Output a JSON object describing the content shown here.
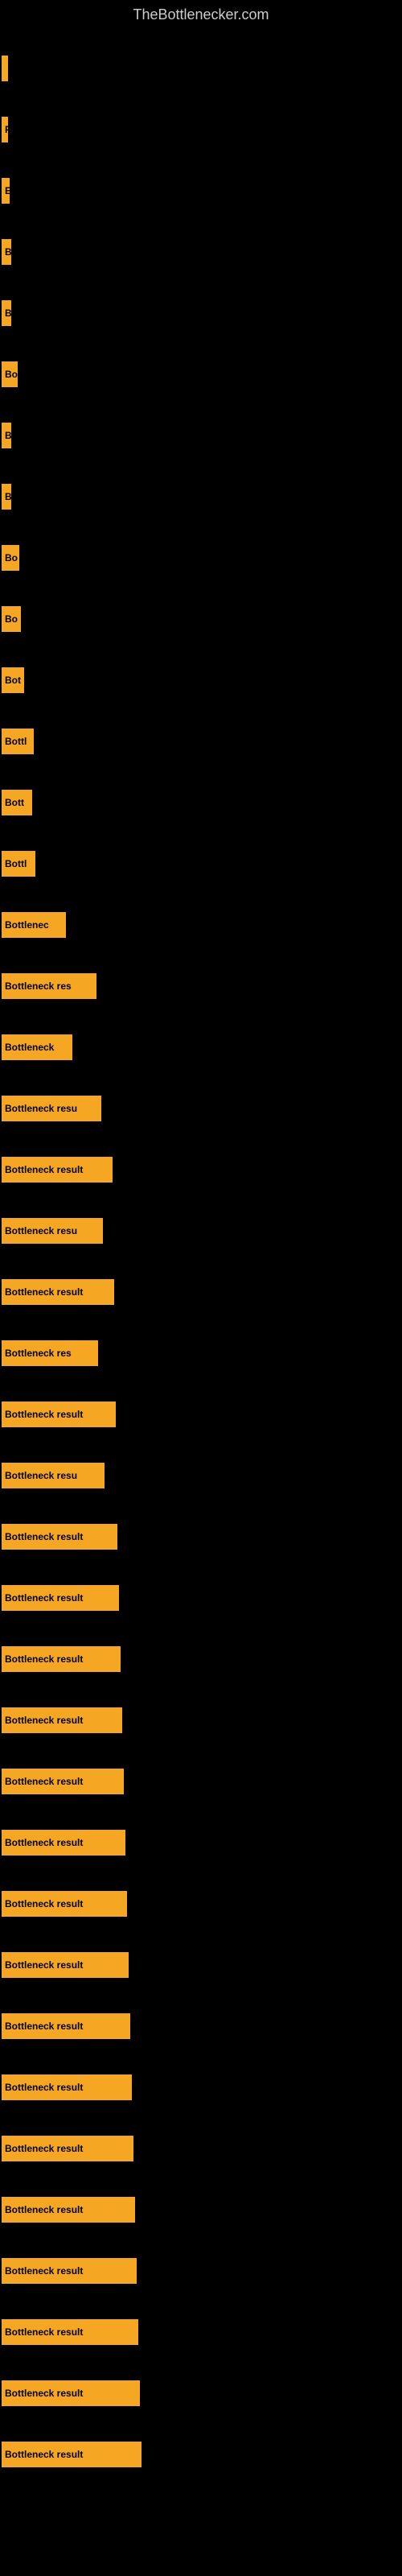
{
  "site": {
    "title": "TheBottlenecker.com"
  },
  "bars": [
    {
      "id": 1,
      "label": "",
      "width": 2
    },
    {
      "id": 2,
      "label": "P",
      "width": 8
    },
    {
      "id": 3,
      "label": "E",
      "width": 10
    },
    {
      "id": 4,
      "label": "B",
      "width": 12
    },
    {
      "id": 5,
      "label": "B",
      "width": 12
    },
    {
      "id": 6,
      "label": "Bo",
      "width": 20
    },
    {
      "id": 7,
      "label": "B",
      "width": 12
    },
    {
      "id": 8,
      "label": "B",
      "width": 12
    },
    {
      "id": 9,
      "label": "Bo",
      "width": 22
    },
    {
      "id": 10,
      "label": "Bo",
      "width": 24
    },
    {
      "id": 11,
      "label": "Bot",
      "width": 28
    },
    {
      "id": 12,
      "label": "Bottl",
      "width": 40
    },
    {
      "id": 13,
      "label": "Bott",
      "width": 38
    },
    {
      "id": 14,
      "label": "Bottl",
      "width": 42
    },
    {
      "id": 15,
      "label": "Bottlenec",
      "width": 80
    },
    {
      "id": 16,
      "label": "Bottleneck res",
      "width": 118
    },
    {
      "id": 17,
      "label": "Bottleneck",
      "width": 88
    },
    {
      "id": 18,
      "label": "Bottleneck resu",
      "width": 124
    },
    {
      "id": 19,
      "label": "Bottleneck result",
      "width": 138
    },
    {
      "id": 20,
      "label": "Bottleneck resu",
      "width": 126
    },
    {
      "id": 21,
      "label": "Bottleneck result",
      "width": 140
    },
    {
      "id": 22,
      "label": "Bottleneck res",
      "width": 120
    },
    {
      "id": 23,
      "label": "Bottleneck result",
      "width": 142
    },
    {
      "id": 24,
      "label": "Bottleneck resu",
      "width": 128
    },
    {
      "id": 25,
      "label": "Bottleneck result",
      "width": 144
    },
    {
      "id": 26,
      "label": "Bottleneck result",
      "width": 146
    },
    {
      "id": 27,
      "label": "Bottleneck result",
      "width": 148
    },
    {
      "id": 28,
      "label": "Bottleneck result",
      "width": 150
    },
    {
      "id": 29,
      "label": "Bottleneck result",
      "width": 152
    },
    {
      "id": 30,
      "label": "Bottleneck result",
      "width": 154
    },
    {
      "id": 31,
      "label": "Bottleneck result",
      "width": 156
    },
    {
      "id": 32,
      "label": "Bottleneck result",
      "width": 158
    },
    {
      "id": 33,
      "label": "Bottleneck result",
      "width": 160
    },
    {
      "id": 34,
      "label": "Bottleneck result",
      "width": 162
    },
    {
      "id": 35,
      "label": "Bottleneck result",
      "width": 164
    },
    {
      "id": 36,
      "label": "Bottleneck result",
      "width": 166
    },
    {
      "id": 37,
      "label": "Bottleneck result",
      "width": 168
    },
    {
      "id": 38,
      "label": "Bottleneck result",
      "width": 170
    },
    {
      "id": 39,
      "label": "Bottleneck result",
      "width": 172
    },
    {
      "id": 40,
      "label": "Bottleneck result",
      "width": 174
    }
  ]
}
